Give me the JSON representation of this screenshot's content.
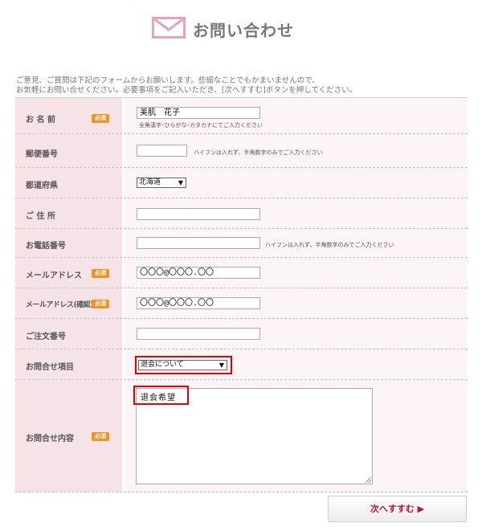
{
  "header": {
    "title": "お問い合わせ",
    "icon": "mail-icon"
  },
  "intro": {
    "line1": "ご意見、ご質問は下記のフォームからお願いします。些細なことでもかまいませんので、",
    "line2": "お気軽にお問い合せください。必要事項をご記入いただき、[次へすすむ]ボタンを押してください。"
  },
  "required_label": "必須",
  "fields": {
    "name": {
      "label": "お 名 前",
      "value": "美肌　花子",
      "hint": "全角漢字･ひらがな･カタカナにてご入力ください"
    },
    "postal": {
      "label": "郵便番号",
      "value": "",
      "hint": "ハイフンは入れず、半角数字のみでご入力ください"
    },
    "prefecture": {
      "label": "都道府県",
      "selected": "北海道"
    },
    "address": {
      "label": "ご 住 所",
      "value": ""
    },
    "phone": {
      "label": "お電話番号",
      "value": "",
      "hint": "ハイフンは入れず、半角数字のみでご入力ください"
    },
    "email": {
      "label": "メールアドレス",
      "value": "〇〇〇@〇〇〇.〇〇"
    },
    "email_confirm": {
      "label": "メールアドレス(確認)",
      "value": "〇〇〇@〇〇〇.〇〇"
    },
    "order_no": {
      "label": "ご注文番号",
      "value": ""
    },
    "inquiry_type": {
      "label": "お問合せ項目",
      "selected": "退会について"
    },
    "inquiry_body": {
      "label": "お問合せ内容",
      "value": "退会希望"
    }
  },
  "buttons": {
    "next": "次へすすむ ▶"
  },
  "colors": {
    "label_bg": "#f6e3e7",
    "value_bg": "#fdf4f6",
    "required_badge": "#f39221",
    "highlight": "#e00000"
  }
}
